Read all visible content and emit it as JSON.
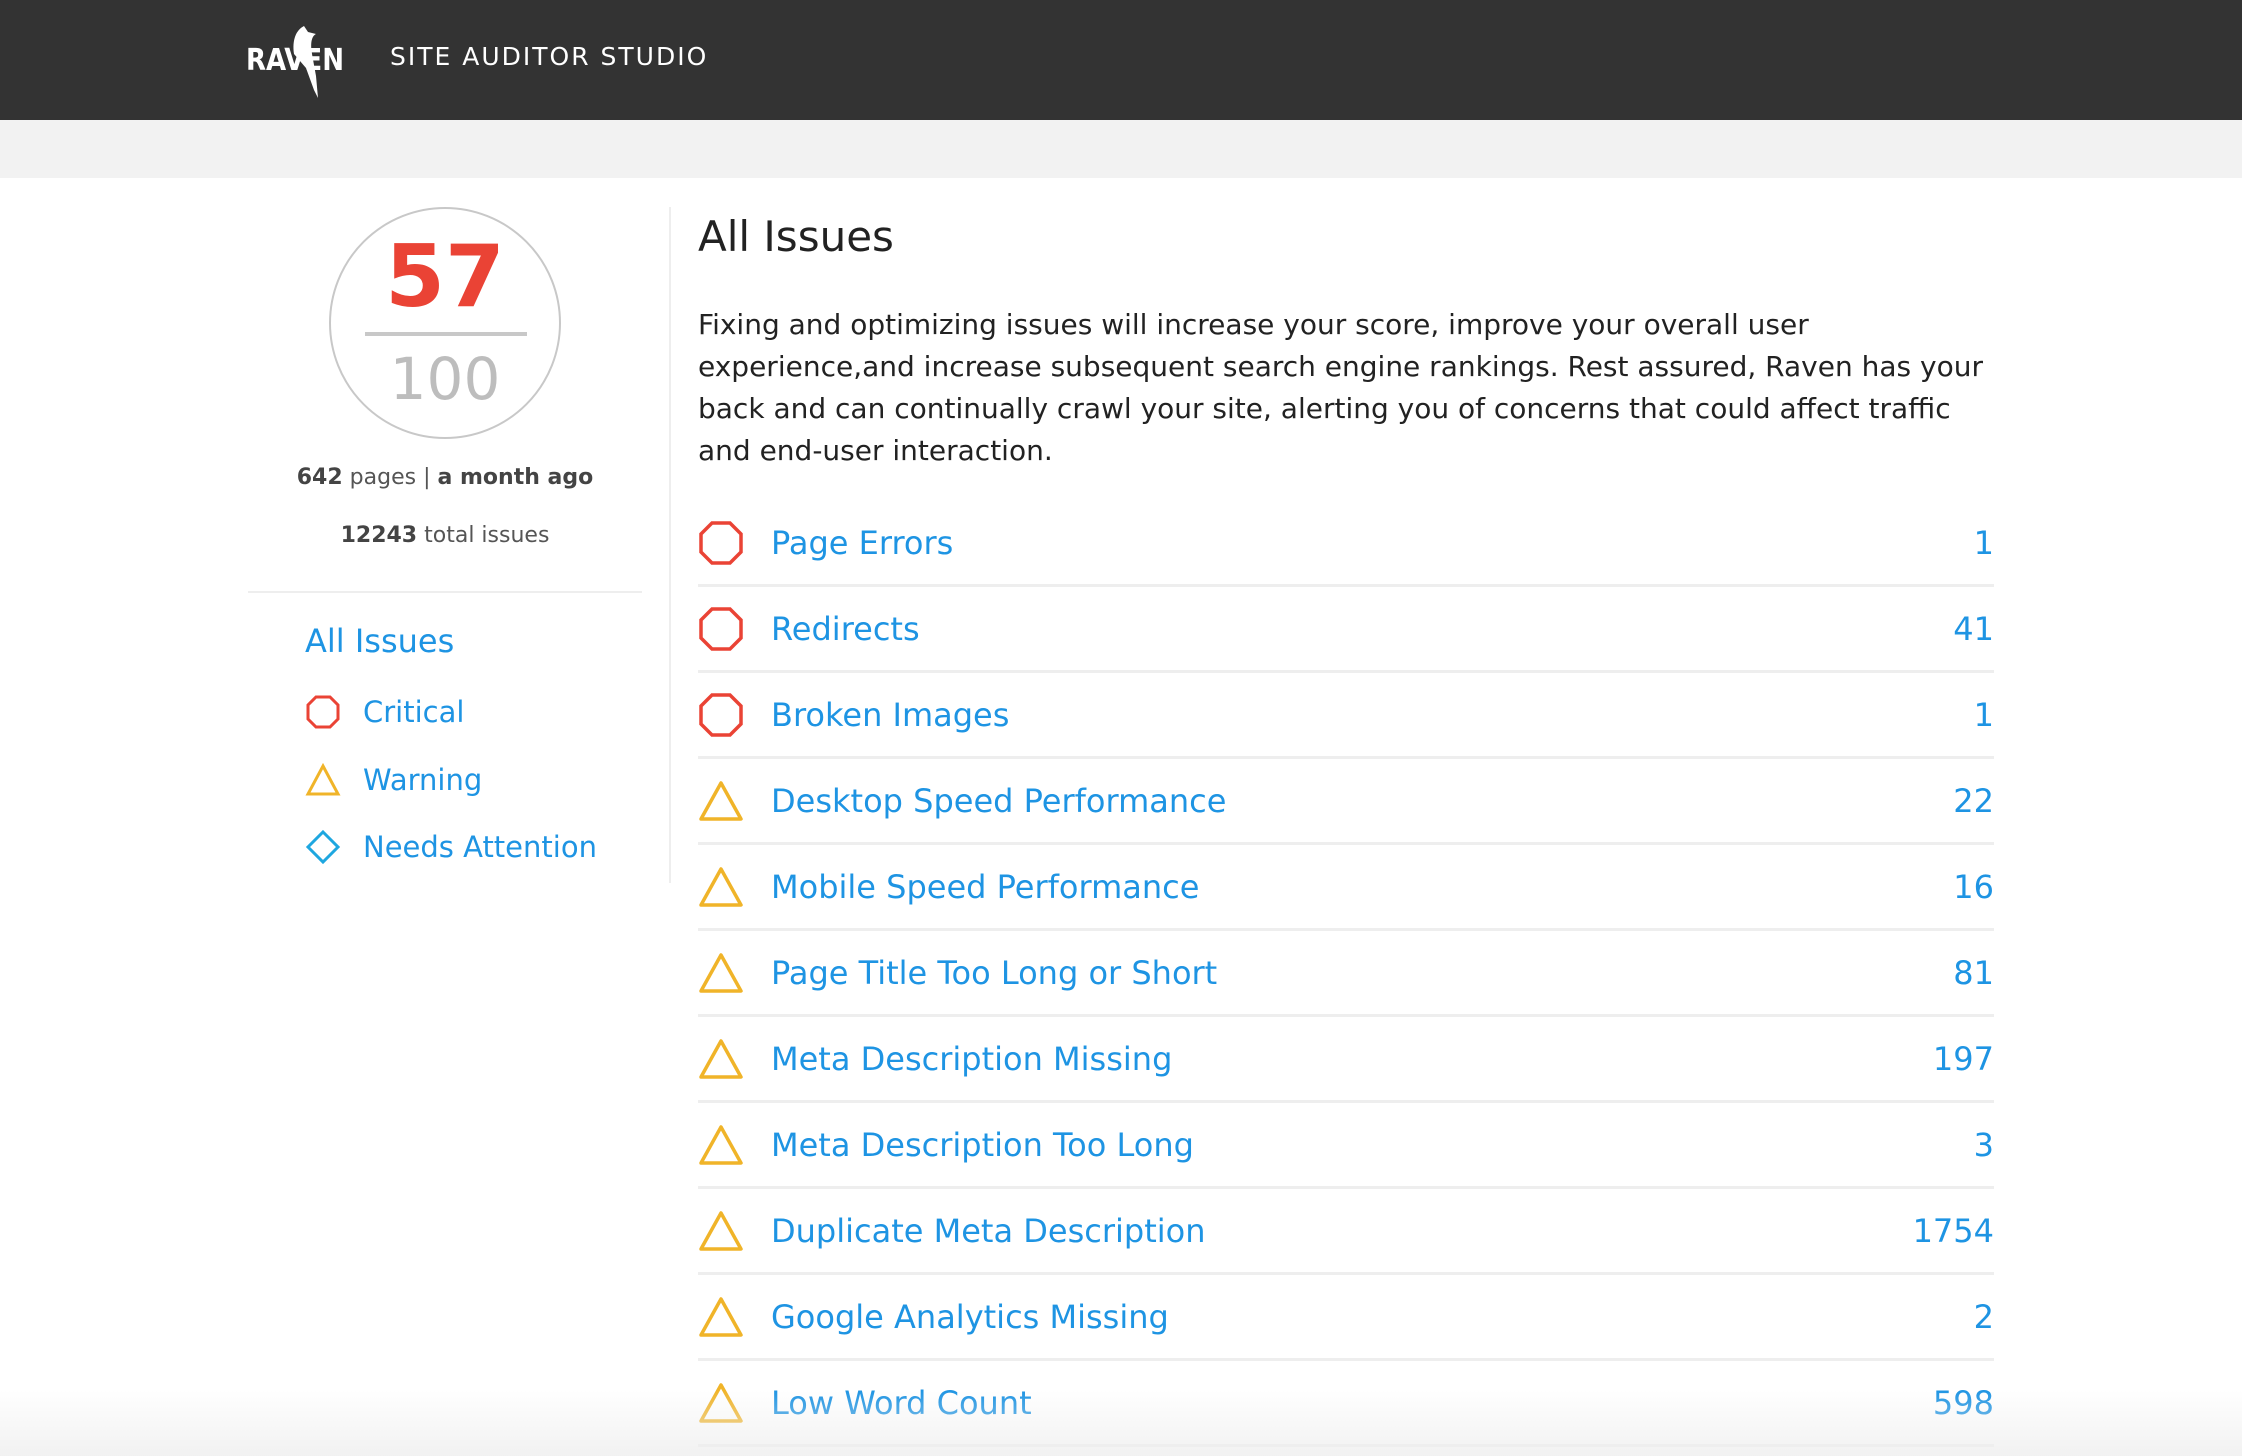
{
  "header": {
    "logo_text": "RAVEN",
    "app_title": "SITE AUDITOR STUDIO"
  },
  "score": {
    "value": "57",
    "max": "100",
    "pages": "642",
    "pages_label": "pages",
    "separator": "|",
    "last_crawl": "a month ago",
    "total_issues": "12243",
    "total_issues_label": "total issues"
  },
  "sidebar": {
    "all_issues": "All Issues",
    "items": [
      {
        "label": "Critical",
        "icon": "octagon-icon"
      },
      {
        "label": "Warning",
        "icon": "triangle-icon"
      },
      {
        "label": "Needs Attention",
        "icon": "diamond-icon"
      }
    ]
  },
  "main": {
    "title": "All Issues",
    "description": "Fixing and optimizing issues will increase your score, improve your overall user experience,and increase subsequent search engine rankings. Rest assured, Raven has your back and can continually crawl your site, alerting you of concerns that could affect traffic and end-user interaction.",
    "issues": [
      {
        "label": "Page Errors",
        "count": "1",
        "severity": "critical"
      },
      {
        "label": "Redirects",
        "count": "41",
        "severity": "critical"
      },
      {
        "label": "Broken Images",
        "count": "1",
        "severity": "critical"
      },
      {
        "label": "Desktop Speed Performance",
        "count": "22",
        "severity": "warning"
      },
      {
        "label": "Mobile Speed Performance",
        "count": "16",
        "severity": "warning"
      },
      {
        "label": "Page Title Too Long or Short",
        "count": "81",
        "severity": "warning"
      },
      {
        "label": "Meta Description Missing",
        "count": "197",
        "severity": "warning"
      },
      {
        "label": "Meta Description Too Long",
        "count": "3",
        "severity": "warning"
      },
      {
        "label": "Duplicate Meta Description",
        "count": "1754",
        "severity": "warning"
      },
      {
        "label": "Google Analytics Missing",
        "count": "2",
        "severity": "warning"
      },
      {
        "label": "Low Word Count",
        "count": "598",
        "severity": "warning"
      }
    ]
  },
  "colors": {
    "critical": "#ea4335",
    "warning": "#f0b429",
    "attention": "#1ea7e0",
    "link": "#1e94e3",
    "header": "#333333"
  }
}
